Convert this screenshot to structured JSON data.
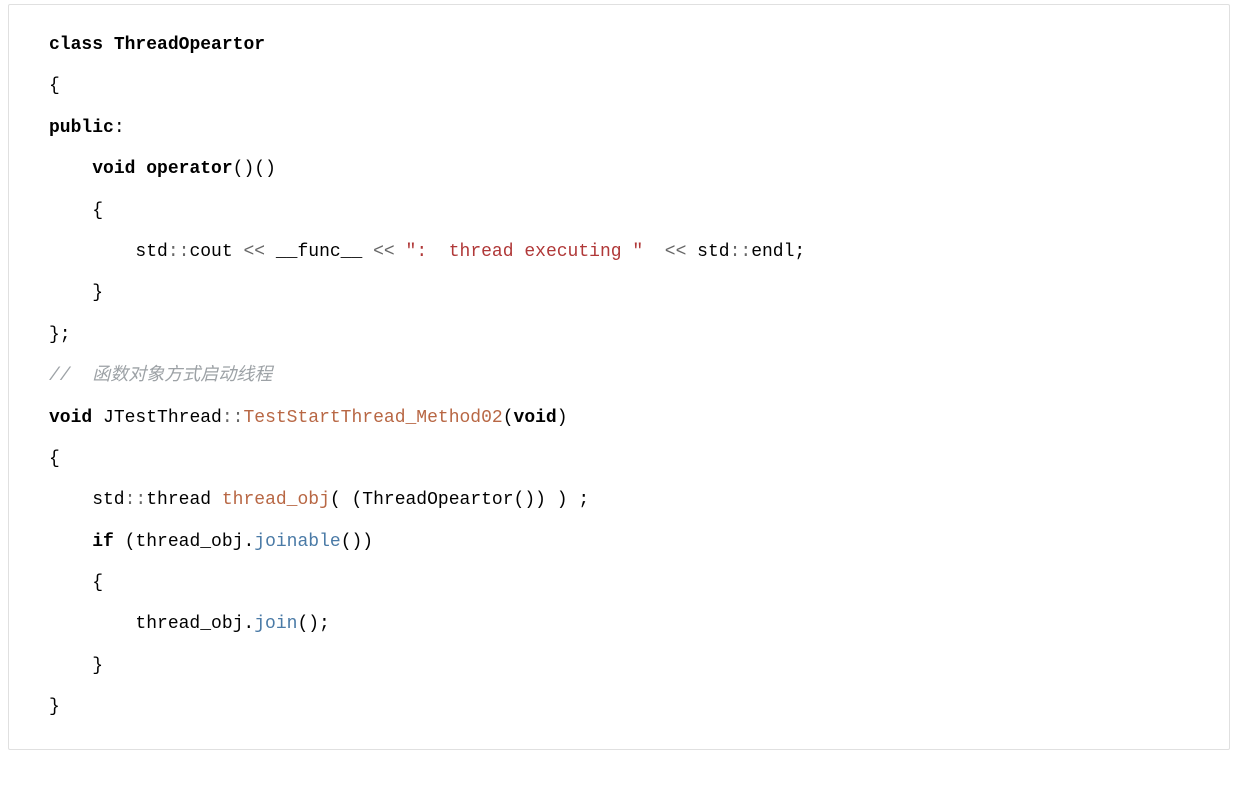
{
  "code": {
    "l1_kw_class": "class",
    "l1_cls": "ThreadOpeartor",
    "l2": "{",
    "l3_kw_public": "public",
    "l3_colon": ":",
    "l4_kw_void": "void",
    "l4_kw_operator": "operator",
    "l4_paren": "()()",
    "l5": "    {",
    "l6_std": "        std",
    "l6_dcolon1": "::",
    "l6_cout": "cout ",
    "l6_ll1": "<<",
    "l6_func": " __func__ ",
    "l6_ll2": "<<",
    "l6_sp1": " ",
    "l6_str": "\":  thread executing \"",
    "l6_sp2": "  ",
    "l6_ll3": "<<",
    "l6_std2": " std",
    "l6_dcolon2": "::",
    "l6_endl": "endl;",
    "l7": "    }",
    "l8": "",
    "l9": "};",
    "l10": "",
    "l11_cmt": "//  函数对象方式启动线程",
    "l12_kw_void": "void",
    "l12_sp": " ",
    "l12_cls": "JTestThread",
    "l12_dcolon": "::",
    "l12_fn": "TestStartThread_Method02",
    "l12_open": "(",
    "l12_kw_void2": "void",
    "l12_close": ")",
    "l13": "{",
    "l14_std": "    std",
    "l14_dcolon": "::",
    "l14_thread": "thread ",
    "l14_obj": "thread_obj",
    "l14_paren": "( (ThreadOpeartor()) ) ;",
    "l15_if": "if",
    "l15_sp": " ",
    "l15_open": "(thread_obj.",
    "l15_fn": "joinable",
    "l15_close": "())",
    "l16": "    {",
    "l17_obj": "        thread_obj.",
    "l17_fn": "join",
    "l17_close": "();",
    "l18": "    }",
    "l19": "}"
  }
}
